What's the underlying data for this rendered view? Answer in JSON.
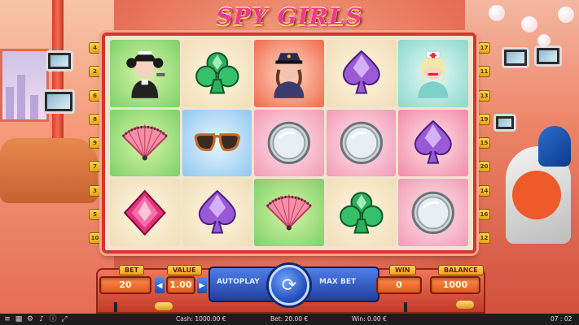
{
  "game": {
    "title": "SPY GIRLS"
  },
  "reels": [
    [
      {
        "symbol": "maid-girl-icon",
        "bg": "green"
      },
      {
        "symbol": "green-club-gem-icon",
        "bg": "cream"
      },
      {
        "symbol": "police-girl-icon",
        "bg": "red"
      },
      {
        "symbol": "purple-spade-gem-icon",
        "bg": "cream"
      },
      {
        "symbol": "nurse-girl-icon",
        "bg": "teal"
      }
    ],
    [
      {
        "symbol": "pink-fan-icon",
        "bg": "green"
      },
      {
        "symbol": "sunglasses-icon",
        "bg": "blue"
      },
      {
        "symbol": "compact-mirror-icon",
        "bg": "rose"
      },
      {
        "symbol": "compact-mirror-icon",
        "bg": "rose"
      },
      {
        "symbol": "purple-spade-gem-icon",
        "bg": "pink"
      }
    ],
    [
      {
        "symbol": "pink-diamond-gem-icon",
        "bg": "cream"
      },
      {
        "symbol": "purple-spade-gem-icon",
        "bg": "cream"
      },
      {
        "symbol": "pink-fan-icon",
        "bg": "green"
      },
      {
        "symbol": "green-club-gem-icon",
        "bg": "cream"
      },
      {
        "symbol": "compact-mirror-icon",
        "bg": "rose"
      }
    ]
  ],
  "lines_left": [
    "4",
    "2",
    "6",
    "8",
    "9",
    "7",
    "3",
    "5",
    "10"
  ],
  "lines_right": [
    "17",
    "11",
    "13",
    "19",
    "15",
    "20",
    "14",
    "16",
    "12"
  ],
  "controls": {
    "bet_label": "BET",
    "bet_value": "20",
    "value_label": "VALUE",
    "value_value": "1.00",
    "autoplay_label": "AUTOPLAY",
    "maxbet_label": "MAX BET",
    "win_label": "WIN",
    "win_value": "0",
    "balance_label": "BALANCE",
    "balance_value": "1000"
  },
  "statusbar": {
    "cash": "Cash: 1000.00 €",
    "bet": "Bet: 20.00 €",
    "win": "Win: 0.00 €",
    "time": "07 : 02"
  },
  "colors": {
    "frame": "#d4362c",
    "panel": "#c33a27",
    "spin": "#1f49b8",
    "chip": "#f2a115"
  }
}
